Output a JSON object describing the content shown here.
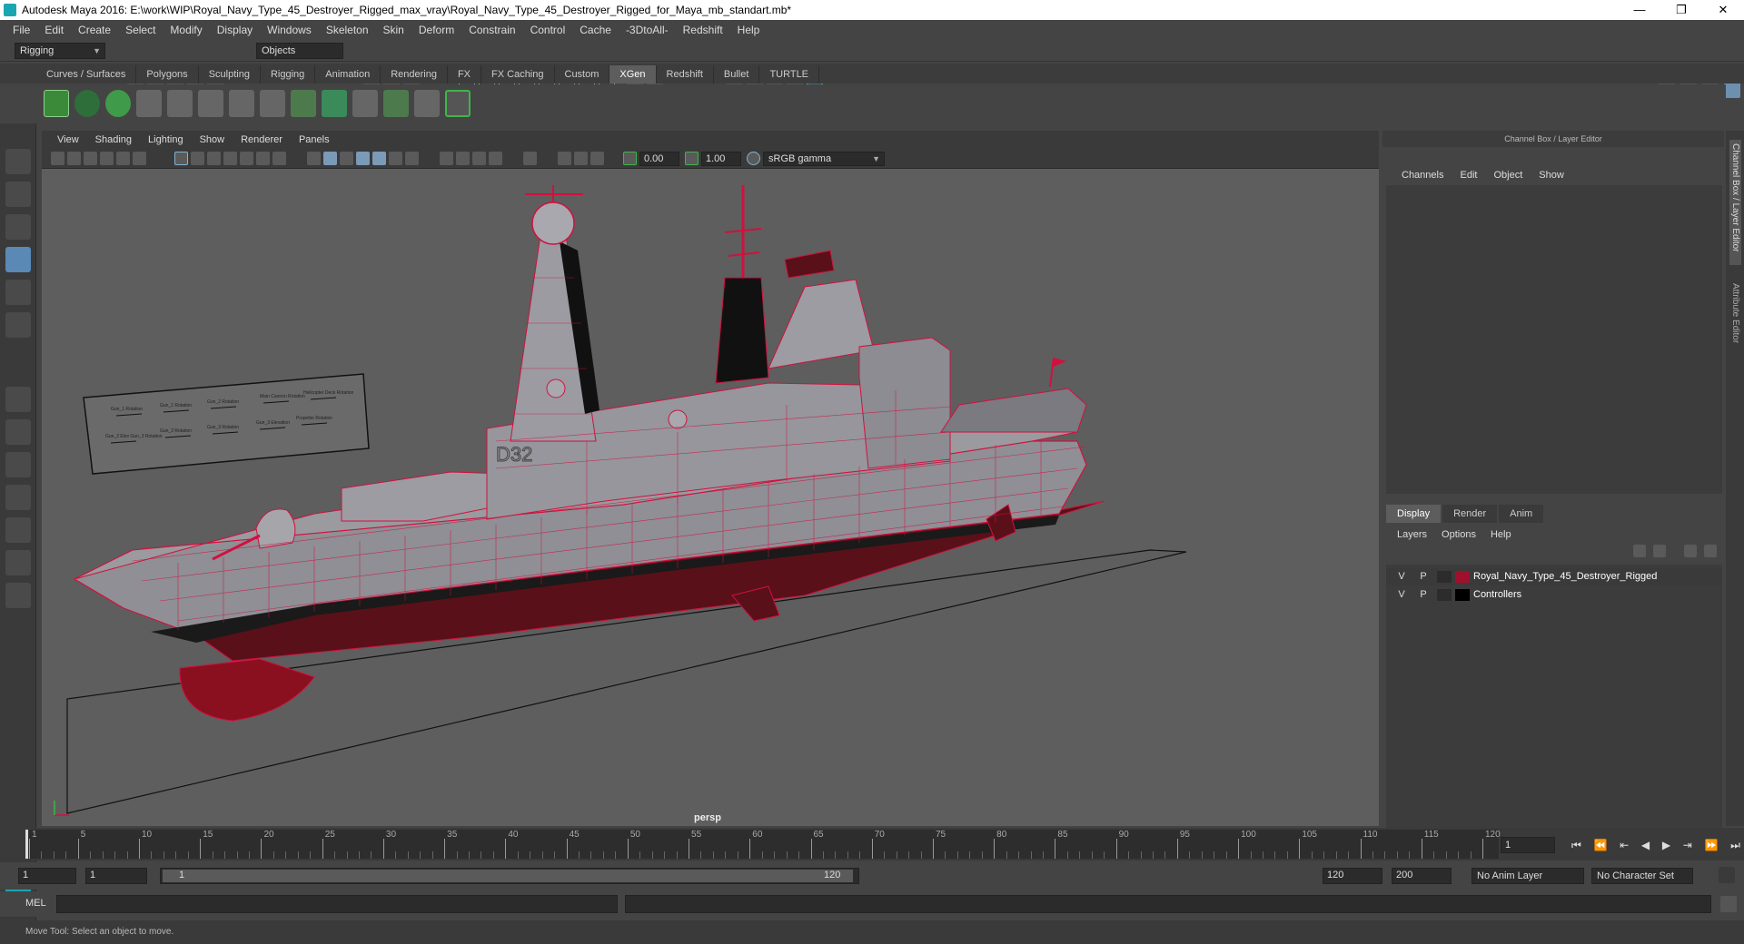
{
  "window": {
    "title": "Autodesk Maya 2016: E:\\work\\WIP\\Royal_Navy_Type_45_Destroyer_Rigged_max_vray\\Royal_Navy_Type_45_Destroyer_Rigged_for_Maya_mb_standart.mb*",
    "minimize": "—",
    "restore": "❐",
    "close": "✕"
  },
  "menu": [
    "File",
    "Edit",
    "Create",
    "Select",
    "Modify",
    "Display",
    "Windows",
    "Skeleton",
    "Skin",
    "Deform",
    "Constrain",
    "Control",
    "Cache",
    "-3DtoAll-",
    "Redshift",
    "Help"
  ],
  "status": {
    "mode": "Rigging",
    "selection": "Objects"
  },
  "shelf_tabs": [
    "Curves / Surfaces",
    "Polygons",
    "Sculpting",
    "Rigging",
    "Animation",
    "Rendering",
    "FX",
    "FX Caching",
    "Custom",
    "XGen",
    "Redshift",
    "Bullet",
    "TURTLE"
  ],
  "active_shelf_tab": "XGen",
  "viewport": {
    "menu": [
      "View",
      "Shading",
      "Lighting",
      "Show",
      "Renderer",
      "Panels"
    ],
    "exposure": "0.00",
    "gamma": "1.00",
    "colorspace": "sRGB gamma",
    "camera": "persp",
    "hull_number": "D32",
    "control_labels": [
      "Gun_1 Rotation",
      "Gun_1 Rotation",
      "Gun_2 Rotation",
      "Main Cannon Rotation",
      "Helicopter Deck Rotation",
      "Gun_2 Rotation",
      "Gun_3 Rotation",
      "Gun_3 Elevation",
      "Propeller Rotation",
      "Gun_2 Elev Gun_3 Rotation"
    ]
  },
  "channel_box": {
    "header": "Channel Box / Layer Editor",
    "menu": [
      "Channels",
      "Edit",
      "Object",
      "Show"
    ],
    "side_tabs": [
      "Channel Box / Layer Editor",
      "Attribute Editor"
    ]
  },
  "layer_editor": {
    "tabs": [
      "Display",
      "Render",
      "Anim"
    ],
    "active_tab": "Display",
    "menu": [
      "Layers",
      "Options",
      "Help"
    ],
    "layers": [
      {
        "v": "V",
        "p": "P",
        "color": "#a0102c",
        "name": "Royal_Navy_Type_45_Destroyer_Rigged"
      },
      {
        "v": "V",
        "p": "P",
        "color": "#000000",
        "name": "Controllers"
      }
    ]
  },
  "timeline": {
    "labels": [
      "1",
      "5",
      "10",
      "15",
      "20",
      "25",
      "30",
      "35",
      "40",
      "45",
      "50",
      "55",
      "60",
      "65",
      "70",
      "75",
      "80",
      "85",
      "90",
      "95",
      "100",
      "105",
      "110",
      "115",
      "120"
    ],
    "current_frame": "1"
  },
  "range": {
    "start": "1",
    "playback_start": "1",
    "slider_start": "1",
    "slider_end": "120",
    "playback_end": "120",
    "end": "200",
    "anim_layer": "No Anim Layer",
    "character_set": "No Character Set"
  },
  "command_line": {
    "label": "MEL"
  },
  "help_line": "Move Tool: Select an object to move.",
  "colors": {
    "wire": "#d2103e",
    "hull": "#8f8f95",
    "accent": "#5a89b5",
    "green": "#3fb54a"
  }
}
